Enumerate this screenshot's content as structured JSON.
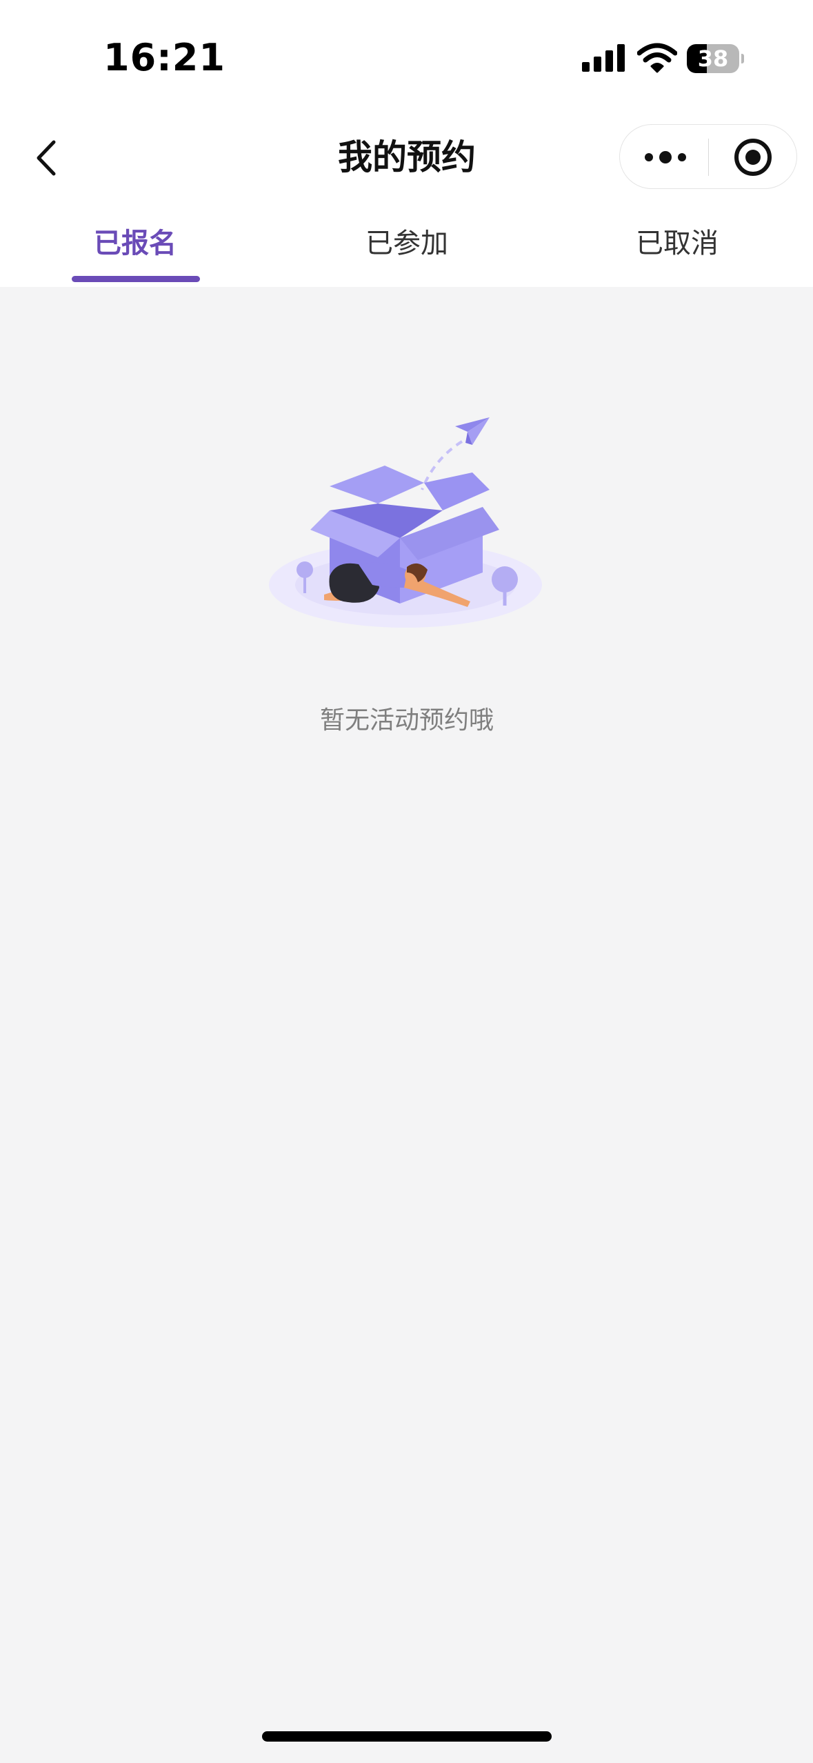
{
  "status_bar": {
    "time": "16:21",
    "battery_level": "38",
    "battery_fraction": 0.38,
    "icons": [
      "signal-icon",
      "wifi-icon",
      "battery-icon"
    ]
  },
  "nav": {
    "title": "我的预约",
    "back_icon": "chevron-left-icon",
    "more_icon": "more-dots-icon",
    "close_icon": "target-close-icon"
  },
  "tabs": [
    {
      "label": "已报名",
      "active": true
    },
    {
      "label": "已参加",
      "active": false
    },
    {
      "label": "已取消",
      "active": false
    }
  ],
  "empty_state": {
    "illustration": "empty-box-illustration",
    "message": "暂无活动预约哦"
  },
  "colors": {
    "accent": "#6a4bb7",
    "background": "#f4f4f5",
    "illustration": "#8f87ec"
  }
}
